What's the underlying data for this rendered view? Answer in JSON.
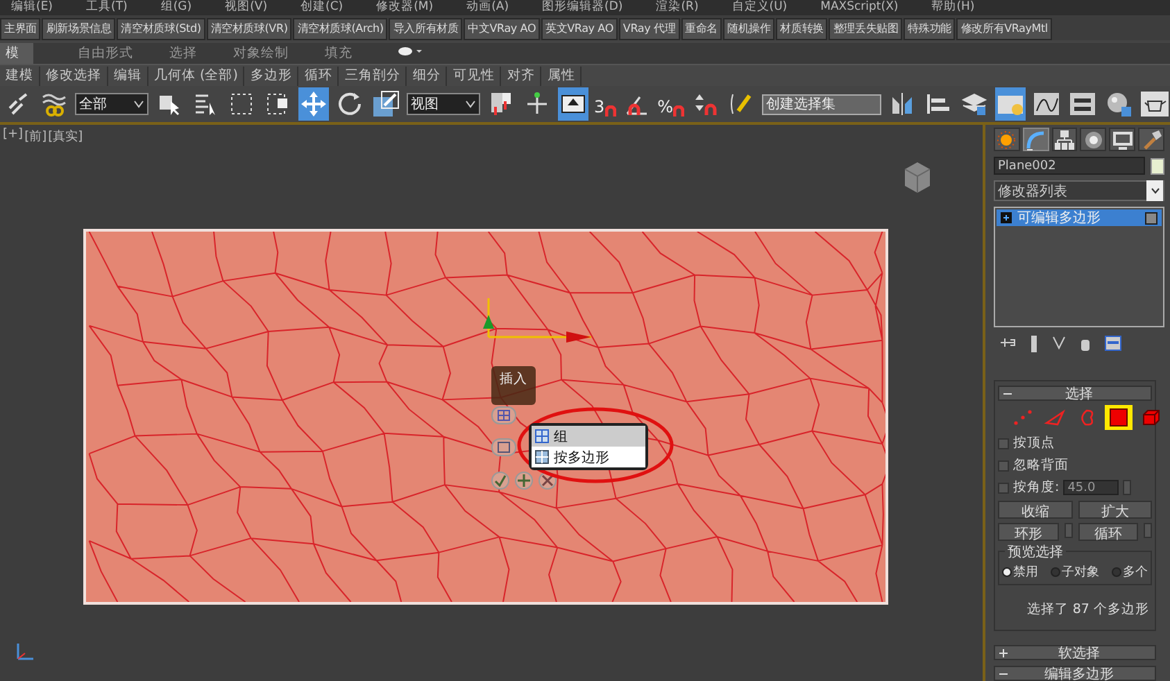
{
  "menu_bar": [
    "编辑(E)",
    "工具(T)",
    "组(G)",
    "视图(V)",
    "创建(C)",
    "修改器(M)",
    "动画(A)",
    "图形编辑器(D)",
    "渲染(R)",
    "自定义(U)",
    "MAXScript(X)",
    "帮助(H)"
  ],
  "custom_toolbar": [
    "主界面",
    "刷新场景信息",
    "清空材质球(Std)",
    "清空材质球(VR)",
    "清空材质球(Arch)",
    "导入所有材质",
    "中文VRay AO",
    "英文VRay AO",
    "VRay 代理",
    "重命名",
    "随机操作",
    "材质转换",
    "整理丢失贴图",
    "特殊功能",
    "修改所有VRayMtl"
  ],
  "ribbon_tabs": [
    {
      "label": "模",
      "selected": true
    },
    {
      "label": "自由形式",
      "selected": false
    },
    {
      "label": "选择",
      "selected": false
    },
    {
      "label": "对象绘制",
      "selected": false
    },
    {
      "label": "填充",
      "selected": false
    }
  ],
  "ribbon_panels": [
    "建模",
    "修改选择",
    "编辑",
    "几何体 (全部)",
    "多边形",
    "循环",
    "三角剖分",
    "细分",
    "可见性",
    "对齐",
    "属性"
  ],
  "main_toolbar": [
    {
      "kind": "link",
      "selected": false
    },
    {
      "kind": "bind",
      "selected": false
    },
    {
      "kind": "dropdown",
      "value": "全部"
    },
    {
      "kind": "select",
      "selected": false
    },
    {
      "kind": "select-by-name",
      "selected": false
    },
    {
      "kind": "rect-select",
      "selected": false
    },
    {
      "kind": "window-crossing",
      "selected": false
    },
    {
      "kind": "move",
      "selected": true
    },
    {
      "kind": "rotate",
      "selected": false
    },
    {
      "kind": "scale",
      "selected": false
    },
    {
      "kind": "dropdown",
      "value": "视图"
    },
    {
      "kind": "pivot",
      "selected": false
    },
    {
      "kind": "manipulate",
      "selected": false
    },
    {
      "kind": "keyboard",
      "selected": true
    },
    {
      "kind": "snap",
      "label": "3"
    },
    {
      "kind": "angle-snap",
      "selected": false
    },
    {
      "kind": "snap",
      "label": "%"
    },
    {
      "kind": "spinner-snap",
      "selected": false
    },
    {
      "kind": "edit-named",
      "selected": false
    },
    {
      "kind": "named-field",
      "placeholder": "创建选择集"
    },
    {
      "kind": "mirror",
      "selected": false
    },
    {
      "kind": "align",
      "selected": false
    },
    {
      "kind": "layers",
      "selected": false
    },
    {
      "kind": "explorer",
      "selected": true
    },
    {
      "kind": "curve",
      "selected": false
    },
    {
      "kind": "schematic",
      "selected": false
    },
    {
      "kind": "material",
      "selected": false
    },
    {
      "kind": "teapot",
      "selected": false
    }
  ],
  "viewport": {
    "labels": [
      "[+]",
      "[前]",
      "[真实]"
    ],
    "caddy_label": "插入",
    "quad_menu": [
      {
        "label": "组",
        "selected": true
      },
      {
        "label": "按多边形",
        "selected": false
      }
    ]
  },
  "command_panel": {
    "tabs": [
      {
        "kind": "create",
        "selected": false
      },
      {
        "kind": "modify",
        "selected": true
      },
      {
        "kind": "hierarchy",
        "selected": false
      },
      {
        "kind": "motion",
        "selected": false
      },
      {
        "kind": "display",
        "selected": false
      },
      {
        "kind": "utilities",
        "selected": false
      }
    ],
    "object_name": "Plane002",
    "modifier_list": "修改器列表",
    "stack": [
      {
        "label": "可编辑多边形",
        "selected": true
      }
    ],
    "selection": {
      "title": "选择",
      "expanded": true,
      "modes": [
        {
          "kind": "vertex",
          "selected": false
        },
        {
          "kind": "edge",
          "selected": false
        },
        {
          "kind": "border",
          "selected": false
        },
        {
          "kind": "polygon",
          "selected": true
        },
        {
          "kind": "element",
          "selected": false
        }
      ],
      "checkboxes": [
        {
          "label": "按顶点",
          "checked": false
        },
        {
          "label": "忽略背面",
          "checked": false
        },
        {
          "label": "按角度:",
          "checked": false
        }
      ],
      "angle_value": "45.0",
      "buttons": [
        "收缩",
        "扩大"
      ],
      "spinner_buttons": [
        "环形",
        "循环"
      ],
      "preview": {
        "title": "预览选择",
        "options": [
          {
            "label": "禁用",
            "selected": true
          },
          {
            "label": "子对象",
            "selected": false
          },
          {
            "label": "多个",
            "selected": false
          }
        ]
      },
      "status": "选择了 87 个多边形"
    },
    "rollouts": [
      {
        "title": "软选择",
        "expanded": false
      },
      {
        "title": "编辑多边形",
        "expanded": true
      }
    ]
  }
}
